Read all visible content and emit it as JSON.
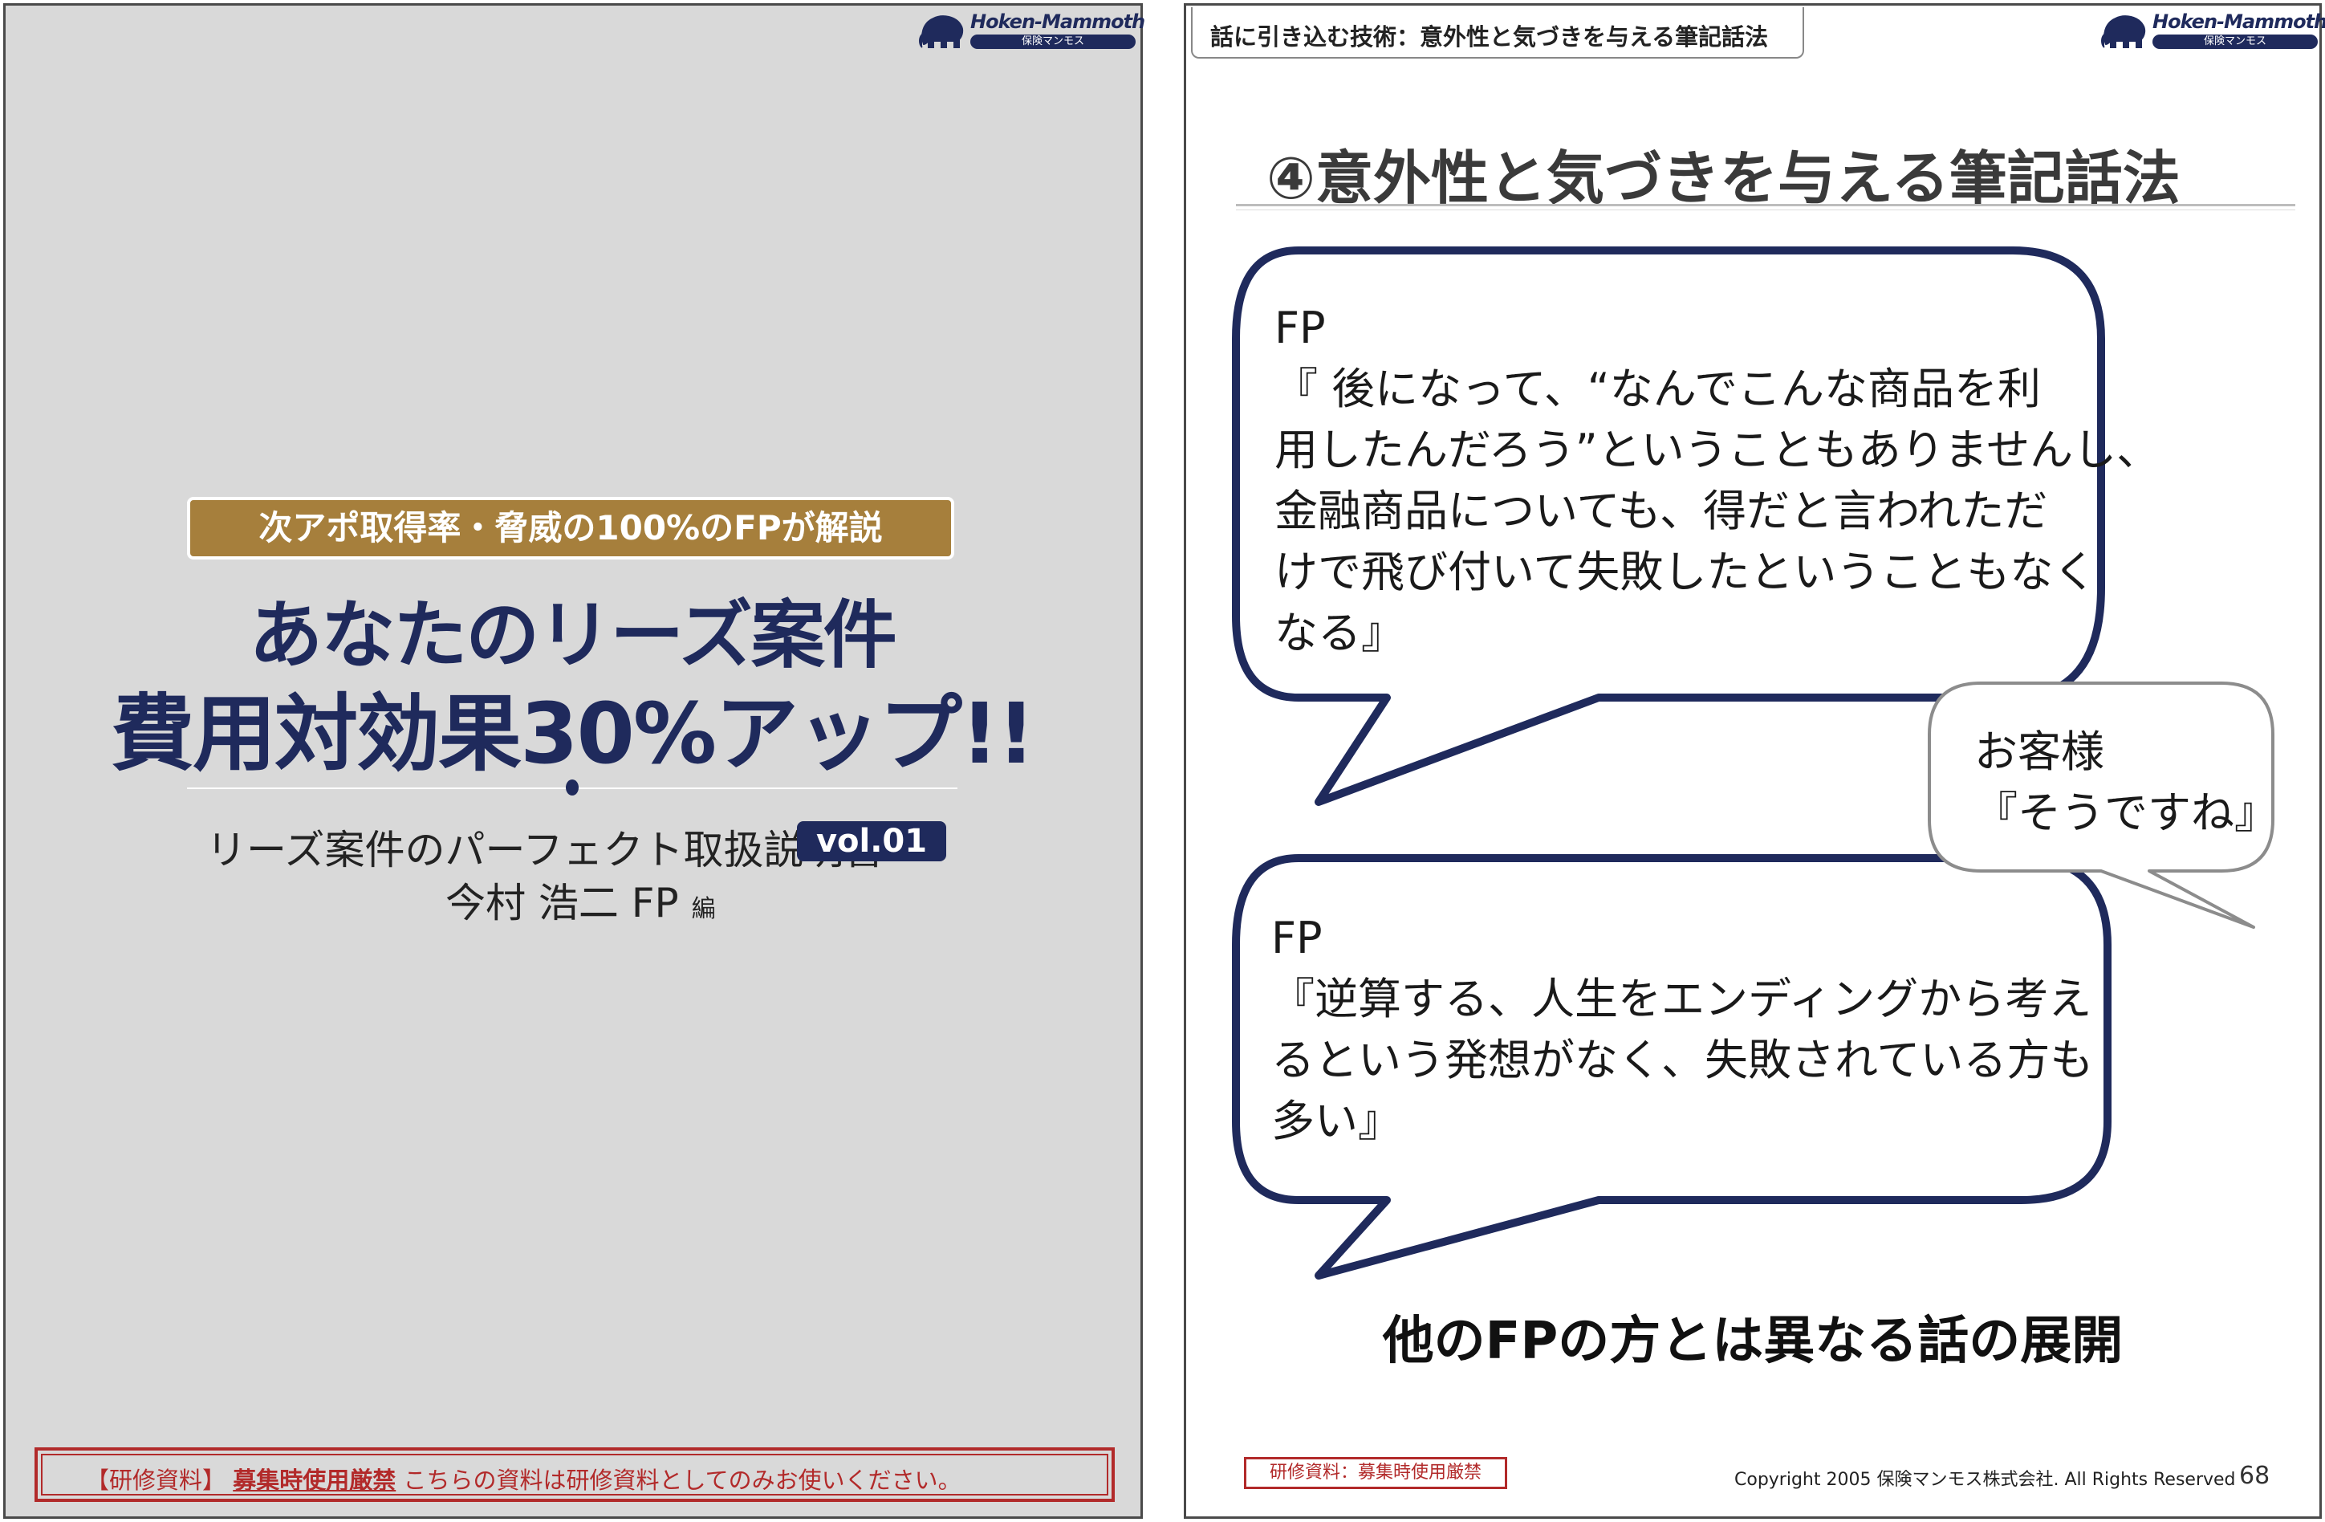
{
  "logo": {
    "brand": "Hoken-Mammoth",
    "tagline": "保険マンモス"
  },
  "cover": {
    "ribbon": "次アポ取得率・脅威の100%のFPが解説",
    "title_line1": "あなたのリーズ案件",
    "title_line2": "費用対効果30%アップ!!",
    "subtitle": "リーズ案件のパーフェクト取扱説明書",
    "vol": "vol.01",
    "author": "今村 浩二 FP",
    "author_suffix": "編",
    "warning_prefix": "【研修資料】",
    "warning_strong": "募集時使用厳禁",
    "warning_rest": "こちらの資料は研修資料としてのみお使いください。"
  },
  "slide": {
    "tag": "話に引き込む技術：意外性と気づきを与える筆記話法",
    "title": "④意外性と気づきを与える筆記話法",
    "bubble1": {
      "speaker": "FP",
      "lines": [
        "『 後になって、“なんでこんな商品を利",
        "用したんだろう”ということもありませんし、",
        "金融商品についても、得だと言われただ",
        "けで飛び付いて失敗したということもなく",
        "なる』"
      ]
    },
    "bubble2": {
      "speaker": "お客様",
      "lines": [
        "『そうですね』"
      ]
    },
    "bubble3": {
      "speaker": "FP",
      "lines": [
        "『逆算する、人生をエンディングから考え",
        "るという発想がなく、失敗されている方も",
        "多い』"
      ]
    },
    "conclusion": "他のFPの方とは異なる話の展開",
    "warning": "研修資料：募集時使用厳禁",
    "copyright": "Copyright 2005 保険マンモス株式会社. All Rights Reserved",
    "page_number": "68"
  },
  "colors": {
    "navy": "#1f2a5c",
    "gold": "#a67f3c",
    "warning_red": "#b22a2a",
    "cover_bg": "#d9d9d9"
  }
}
